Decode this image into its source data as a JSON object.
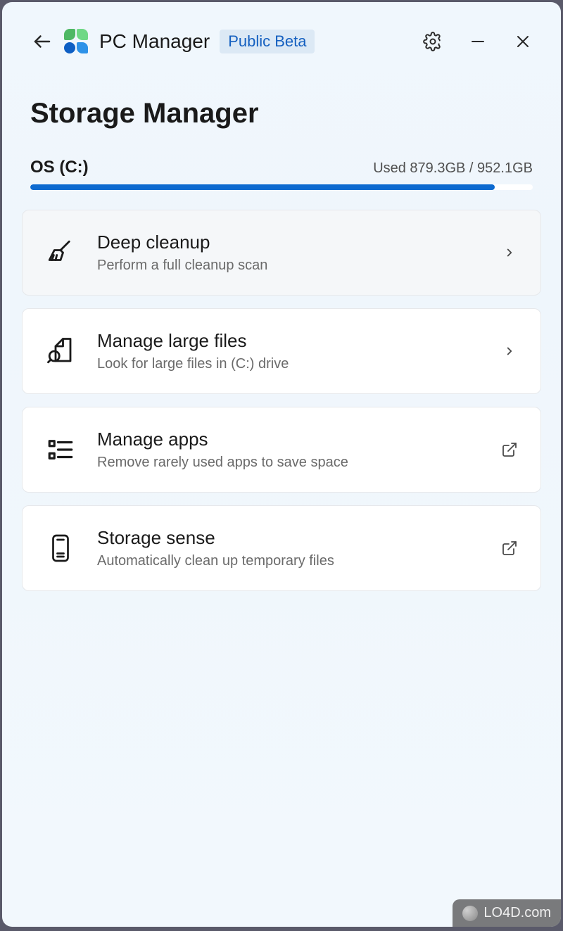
{
  "app": {
    "title": "PC Manager",
    "badge": "Public Beta"
  },
  "page": {
    "title": "Storage Manager"
  },
  "storage": {
    "drive_label": "OS (C:)",
    "usage_text": "Used 879.3GB / 952.1GB",
    "percent": 92.4
  },
  "cards": [
    {
      "title": "Deep cleanup",
      "desc": "Perform a full cleanup scan",
      "action": "chevron",
      "highlighted": true
    },
    {
      "title": "Manage large files",
      "desc": "Look for large files in (C:) drive",
      "action": "chevron",
      "highlighted": false
    },
    {
      "title": "Manage apps",
      "desc": "Remove rarely used apps to save space",
      "action": "external",
      "highlighted": false
    },
    {
      "title": "Storage sense",
      "desc": "Automatically clean up temporary files",
      "action": "external",
      "highlighted": false
    }
  ],
  "watermark": "LO4D.com"
}
